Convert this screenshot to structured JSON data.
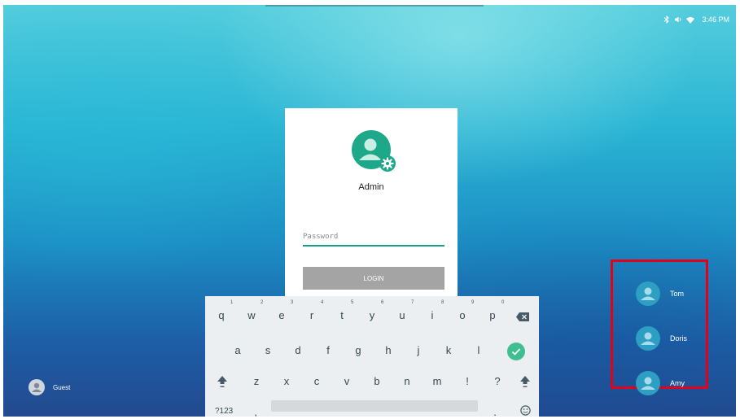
{
  "status_bar": {
    "time": "3:46 PM",
    "icons": [
      "bluetooth-icon",
      "volume-icon",
      "wifi-icon"
    ]
  },
  "login": {
    "user_name": "Admin",
    "password_placeholder": "Password",
    "password_value": "",
    "button_label": "LOGIN"
  },
  "users": [
    {
      "name": "Tom"
    },
    {
      "name": "Doris"
    },
    {
      "name": "Amy"
    }
  ],
  "guest": {
    "label": "Guest"
  },
  "keyboard": {
    "row1": [
      {
        "key": "q",
        "hint": "1"
      },
      {
        "key": "w",
        "hint": "2"
      },
      {
        "key": "e",
        "hint": "3"
      },
      {
        "key": "r",
        "hint": "4"
      },
      {
        "key": "t",
        "hint": "5"
      },
      {
        "key": "y",
        "hint": "6"
      },
      {
        "key": "u",
        "hint": "7"
      },
      {
        "key": "i",
        "hint": "8"
      },
      {
        "key": "o",
        "hint": "9"
      },
      {
        "key": "p",
        "hint": "0"
      }
    ],
    "row2": [
      "a",
      "s",
      "d",
      "f",
      "g",
      "h",
      "j",
      "k",
      "l"
    ],
    "row3": [
      "z",
      "x",
      "c",
      "v",
      "b",
      "n",
      "m",
      "!",
      "?"
    ],
    "row4": {
      "symbols_label": "?123",
      "comma": ",",
      "period": "."
    }
  },
  "colors": {
    "accent": "#16a085",
    "avatar_admin": "#1ea88a",
    "highlight_border": "#e3001b",
    "login_button": "#a4a4a4"
  }
}
